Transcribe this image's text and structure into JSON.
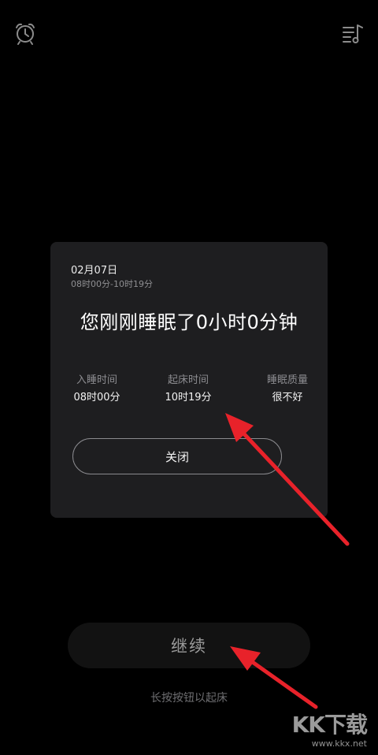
{
  "top_bar": {
    "left_icon": "alarm-clock-icon",
    "right_icon": "music-playlist-icon"
  },
  "summary_card": {
    "date": "02月07日",
    "time_range": "08时00分-10时19分",
    "headline": "您刚刚睡眠了0小时0分钟",
    "stats": [
      {
        "label": "入睡时间",
        "value": "08时00分"
      },
      {
        "label": "起床时间",
        "value": "10时19分"
      },
      {
        "label": "睡眠质量",
        "value": "很不好"
      }
    ],
    "close_label": "关闭"
  },
  "continue_label": "继续",
  "hint": "长按按钮以起床",
  "annotation_color": "#e8222a",
  "watermark": {
    "logo": "KK下载",
    "url": "www.kkx.net"
  }
}
